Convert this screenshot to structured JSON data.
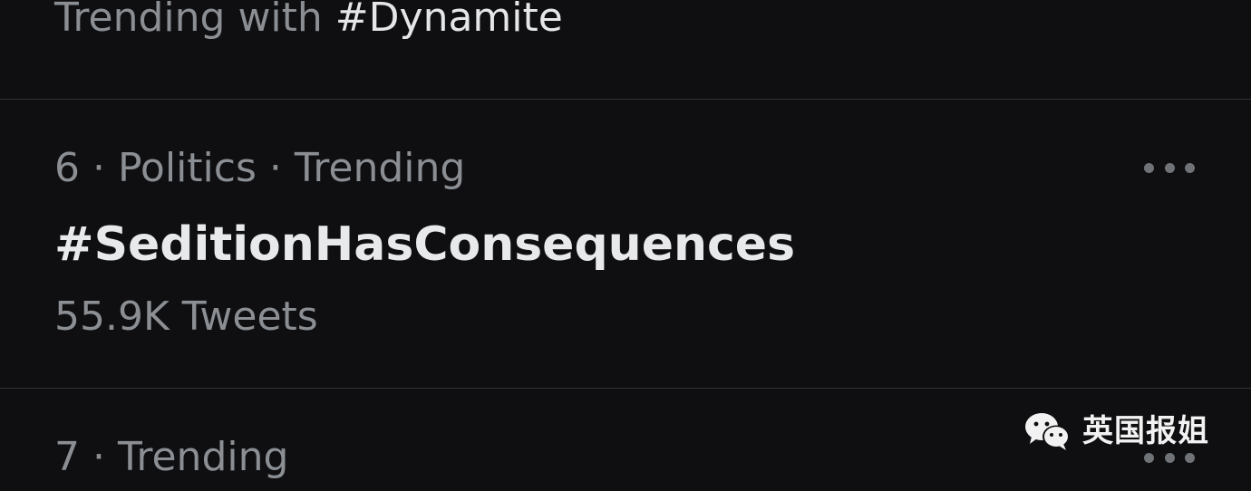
{
  "trends": {
    "previous": {
      "context_prefix": "Trending with",
      "hashtag": "#Dynamite"
    },
    "items": [
      {
        "rank": "6",
        "category": "Politics",
        "status": "Trending",
        "meta_text": "6 · Politics · Trending",
        "name": "#SeditionHasConsequences",
        "tweet_count": "55.9K Tweets"
      },
      {
        "rank": "7",
        "status": "Trending",
        "meta_text": "7 · Trending"
      }
    ]
  },
  "icons": {
    "more": "more-horizontal-icon",
    "watermark_logo": "wechat-icon"
  },
  "watermark": {
    "text": "英国报姐"
  },
  "colors": {
    "background": "#0f0f11",
    "primary_text": "#e7e9ea",
    "secondary_text": "#8b8f94",
    "divider": "#2f3336"
  }
}
